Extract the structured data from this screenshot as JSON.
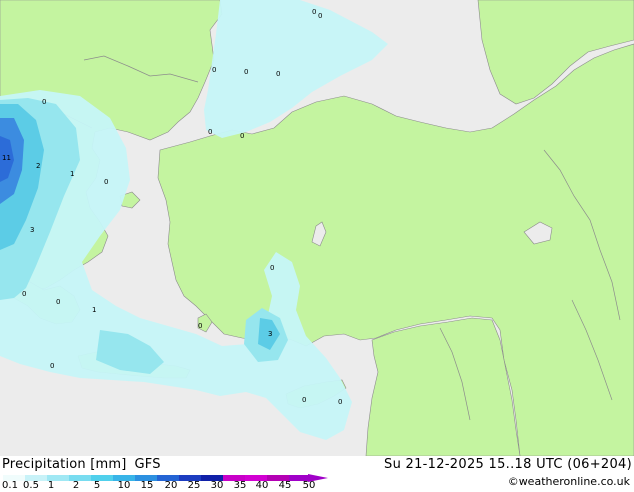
{
  "map": {
    "colors": {
      "land": "#c4f4a0",
      "sea": "#ececec",
      "border": "#8c8c8c",
      "precip_light": "#c6f6f8",
      "precip_mid": "#96e6ee",
      "precip_high": "#5ccce6",
      "precip_heavy": "#3c8ce0",
      "precip_max": "#2c6cd8"
    },
    "labels": [
      "0",
      "0",
      "0",
      "0",
      "0",
      "0",
      "0",
      "2",
      "11",
      "1",
      "0",
      "3",
      "0",
      "0",
      "1",
      "0",
      "0",
      "3",
      "0",
      "0",
      "0",
      "0"
    ]
  },
  "footer": {
    "title": "Precipitation [mm]",
    "model": "GFS",
    "datetime": "Su 21-12-2025 15..18 UTC (06+204)",
    "credit": "©weatheronline.co.uk"
  },
  "legend": {
    "labels": [
      "0.1",
      "0.5",
      "1",
      "2",
      "5",
      "10",
      "15",
      "20",
      "25",
      "30",
      "35",
      "40",
      "45",
      "50"
    ],
    "colors": [
      "#f0fcfc",
      "#c8f2f8",
      "#a0e8f4",
      "#78dcf0",
      "#50d0ec",
      "#38b4e8",
      "#2c90e0",
      "#2464d4",
      "#1c3cc0",
      "#1020a8",
      "#c800c8",
      "#d200d2",
      "#b400b4",
      "#a000c8"
    ]
  }
}
